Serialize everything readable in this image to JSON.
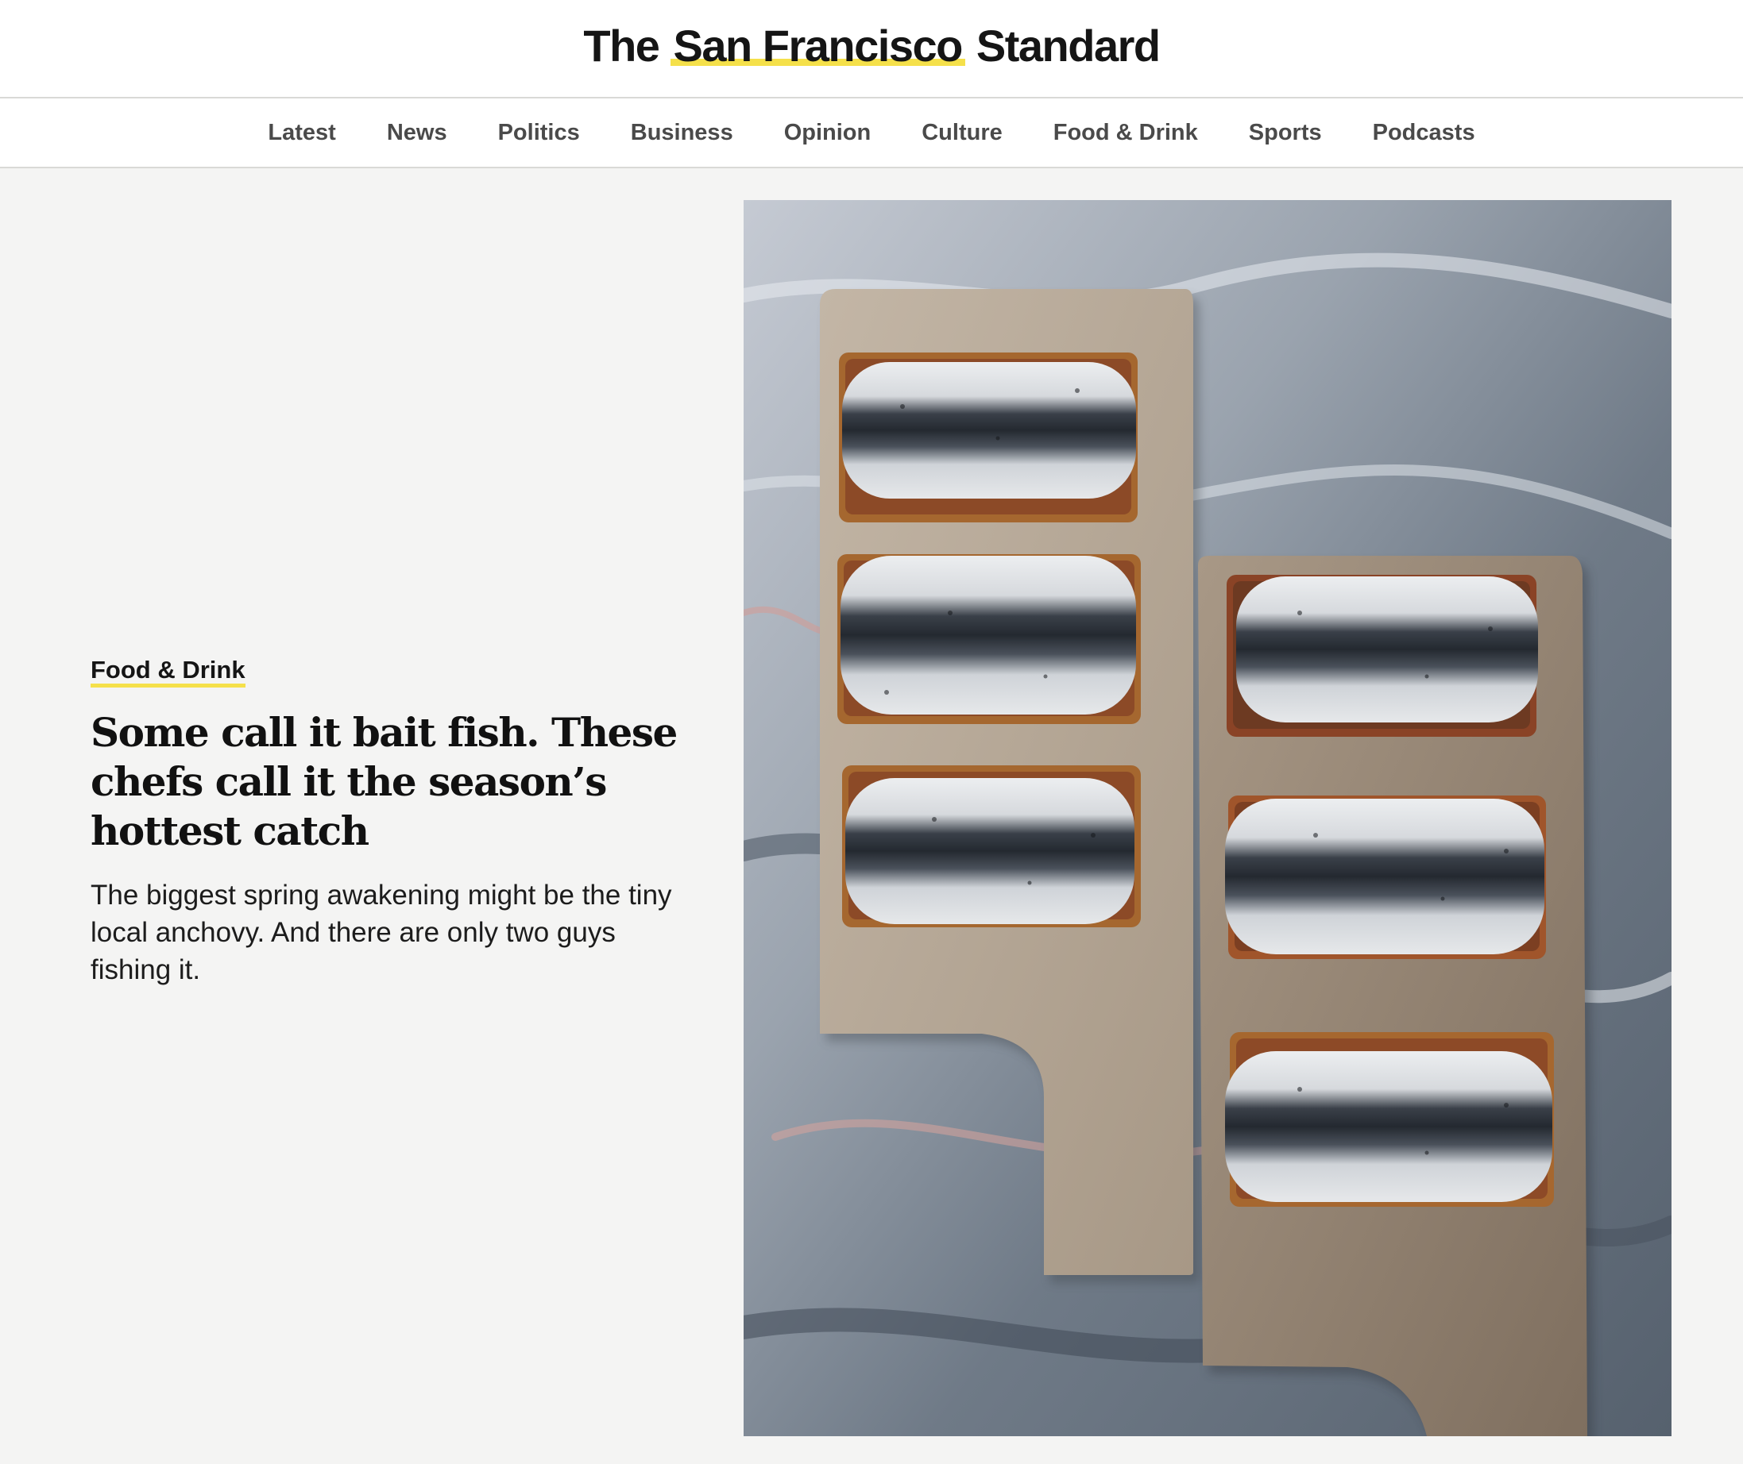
{
  "site": {
    "logo_prefix": "The",
    "logo_highlight": "San Francisco",
    "logo_suffix": "Standard"
  },
  "nav": {
    "items": [
      {
        "label": "Latest"
      },
      {
        "label": "News"
      },
      {
        "label": "Politics"
      },
      {
        "label": "Business"
      },
      {
        "label": "Opinion"
      },
      {
        "label": "Culture"
      },
      {
        "label": "Food & Drink"
      },
      {
        "label": "Sports"
      },
      {
        "label": "Podcasts"
      }
    ]
  },
  "story": {
    "kicker": "Food & Drink",
    "headline": "Some call it bait fish. These chefs call it the season’s hottest catch",
    "dek": "The biggest spring awakening might be the tiny local anchovy. And there are only two guys fishing it."
  },
  "photo": {
    "subject": "marinated anchovies on toasts on two wooden cutting boards over marble"
  },
  "colors": {
    "accent_yellow": "#f5e04a",
    "background": "#f4f4f3",
    "nav_text": "#4a4a4a",
    "marble": "#7f8a97",
    "board_light": "#b9ab9b",
    "board_dark": "#8a7a6a",
    "toast": "#a9692f",
    "fish_silver": "#dcdee0",
    "fish_stripe": "#2b3038"
  }
}
